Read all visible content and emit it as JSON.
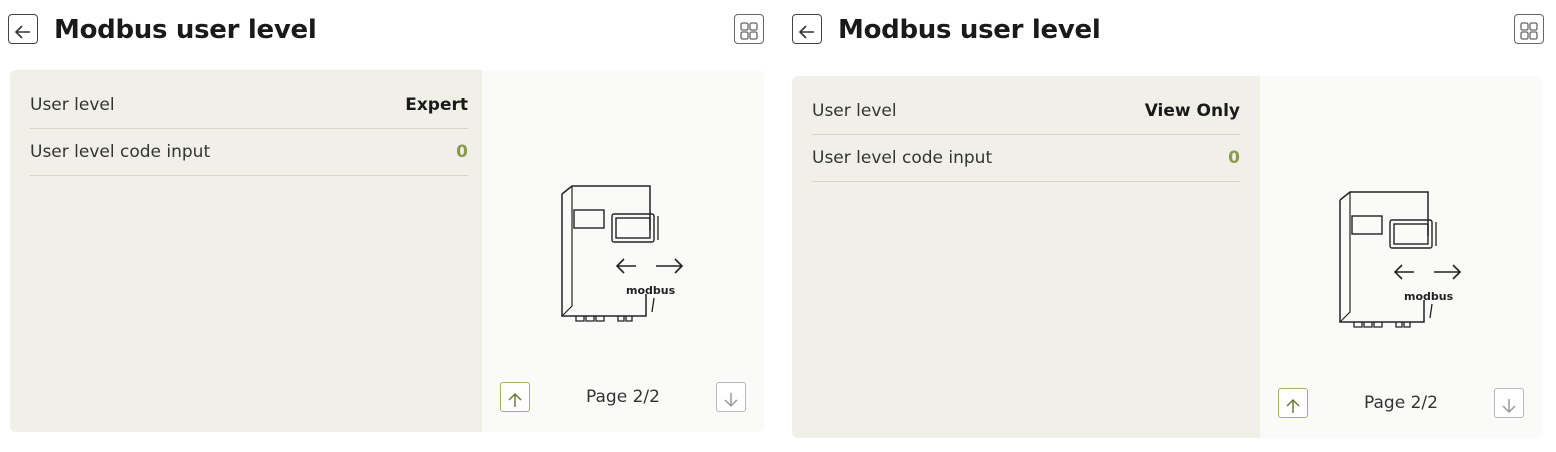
{
  "panels": [
    {
      "title": "Modbus user level",
      "rows": [
        {
          "label": "User level",
          "value": "Expert"
        },
        {
          "label": "User level code input",
          "value": "0"
        }
      ],
      "device_label": "modbus",
      "pager": {
        "text": "Page 2/2"
      }
    },
    {
      "title": "Modbus user level",
      "rows": [
        {
          "label": "User level",
          "value": "View Only"
        },
        {
          "label": "User level code input",
          "value": "0"
        }
      ],
      "device_label": "modbus",
      "pager": {
        "text": "Page 2/2"
      }
    }
  ],
  "icons": {
    "back": "arrow-left-icon",
    "grid": "grid-icon",
    "up": "arrow-up-icon",
    "down": "arrow-down-icon"
  },
  "colors": {
    "card_bg": "#f1f0e8",
    "accent_green": "#8a9a4e",
    "row_divider": "#d5d4c6"
  }
}
